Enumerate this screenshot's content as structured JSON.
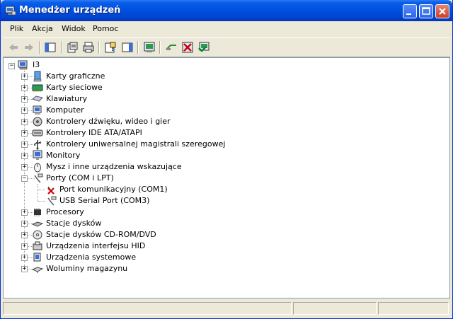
{
  "window": {
    "title": "Menedżer urządzeń"
  },
  "menubar": {
    "items": [
      "Plik",
      "Akcja",
      "Widok",
      "Pomoc"
    ]
  },
  "toolbar": {
    "icons": [
      "back-icon",
      "forward-icon",
      "show-hide-tree-icon",
      "properties-icon",
      "print-icon",
      "help-icon",
      "show-hide-action-pane-icon",
      "scan-hardware-icon",
      "update-driver-icon",
      "uninstall-icon",
      "enable-device-icon"
    ]
  },
  "tree": {
    "root": "I3",
    "items": [
      {
        "label": "Karty graficzne",
        "icon": "display-adapter-icon",
        "expanded": false
      },
      {
        "label": "Karty sieciowe",
        "icon": "network-adapter-icon",
        "expanded": false
      },
      {
        "label": "Klawiatury",
        "icon": "keyboard-icon",
        "expanded": false
      },
      {
        "label": "Komputer",
        "icon": "computer-icon",
        "expanded": false
      },
      {
        "label": "Kontrolery dźwięku, wideo i gier",
        "icon": "sound-icon",
        "expanded": false
      },
      {
        "label": "Kontrolery IDE ATA/ATAPI",
        "icon": "ide-controller-icon",
        "expanded": false
      },
      {
        "label": "Kontrolery uniwersalnej magistrali szeregowej",
        "icon": "usb-icon",
        "expanded": false
      },
      {
        "label": "Monitory",
        "icon": "monitor-icon",
        "expanded": false
      },
      {
        "label": "Mysz i inne urządzenia wskazujące",
        "icon": "mouse-icon",
        "expanded": false
      },
      {
        "label": "Porty (COM i LPT)",
        "icon": "port-icon",
        "expanded": true,
        "children": [
          {
            "label": "Port komunikacyjny (COM1)",
            "icon": "port-disabled-icon"
          },
          {
            "label": "USB Serial Port (COM3)",
            "icon": "port-icon"
          }
        ]
      },
      {
        "label": "Procesory",
        "icon": "processor-icon",
        "expanded": false
      },
      {
        "label": "Stacje dysków",
        "icon": "disk-drive-icon",
        "expanded": false
      },
      {
        "label": "Stacje dysków CD-ROM/DVD",
        "icon": "cdrom-icon",
        "expanded": false
      },
      {
        "label": "Urządzenia interfejsu HID",
        "icon": "hid-icon",
        "expanded": false
      },
      {
        "label": "Urządzenia systemowe",
        "icon": "system-device-icon",
        "expanded": false
      },
      {
        "label": "Woluminy magazynu",
        "icon": "storage-volume-icon",
        "expanded": false
      }
    ]
  },
  "colors": {
    "titlebar": "#0054e3",
    "face": "#ece9d8",
    "accent_red": "#d40000"
  }
}
